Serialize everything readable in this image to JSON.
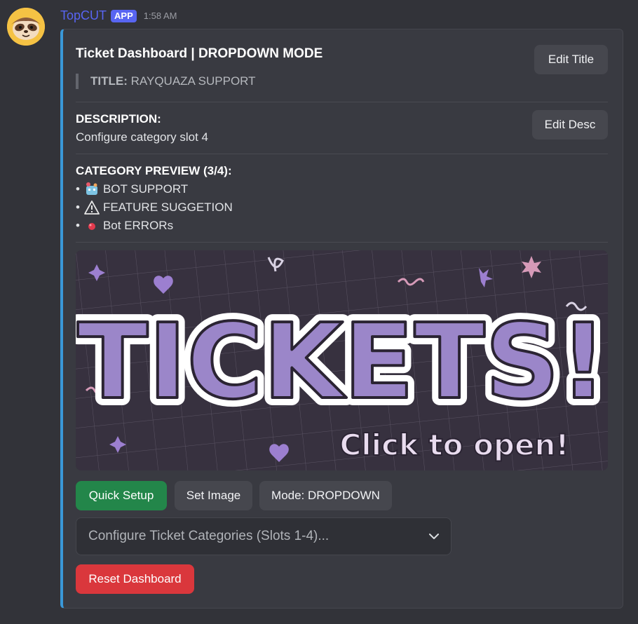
{
  "message": {
    "username": "TopCUT",
    "badge": "APP",
    "timestamp": "1:58 AM"
  },
  "embed": {
    "accent_color": "#3a98d8",
    "title": "Ticket Dashboard | DROPDOWN MODE",
    "edit_title_button": "Edit Title",
    "title_label": "TITLE:",
    "title_value": "RAYQUAZA SUPPORT",
    "description_heading": "DESCRIPTION:",
    "description_text": "Configure category slot 4",
    "edit_desc_button": "Edit Desc",
    "category_heading": "CATEGORY PREVIEW (3/4):",
    "categories": [
      {
        "bullet": "•",
        "icon": "robot-emoji",
        "label": "BOT SUPPORT"
      },
      {
        "bullet": "•",
        "icon": "warning-emoji",
        "label": "FEATURE SUGGETION"
      },
      {
        "bullet": "•",
        "icon": "red-dot-emoji",
        "label": "Bot ERRORs"
      }
    ],
    "banner": {
      "main_text": "TICKETS!",
      "sub_text": "Click to open!"
    }
  },
  "actions": {
    "quick_setup": "Quick Setup",
    "set_image": "Set Image",
    "mode": "Mode: DROPDOWN",
    "select_placeholder": "Configure Ticket Categories (Slots 1-4)...",
    "reset": "Reset Dashboard"
  },
  "colors": {
    "username": "#5865f2",
    "primary_green": "#23864a",
    "danger_red": "#da373c",
    "background": "#323339"
  }
}
